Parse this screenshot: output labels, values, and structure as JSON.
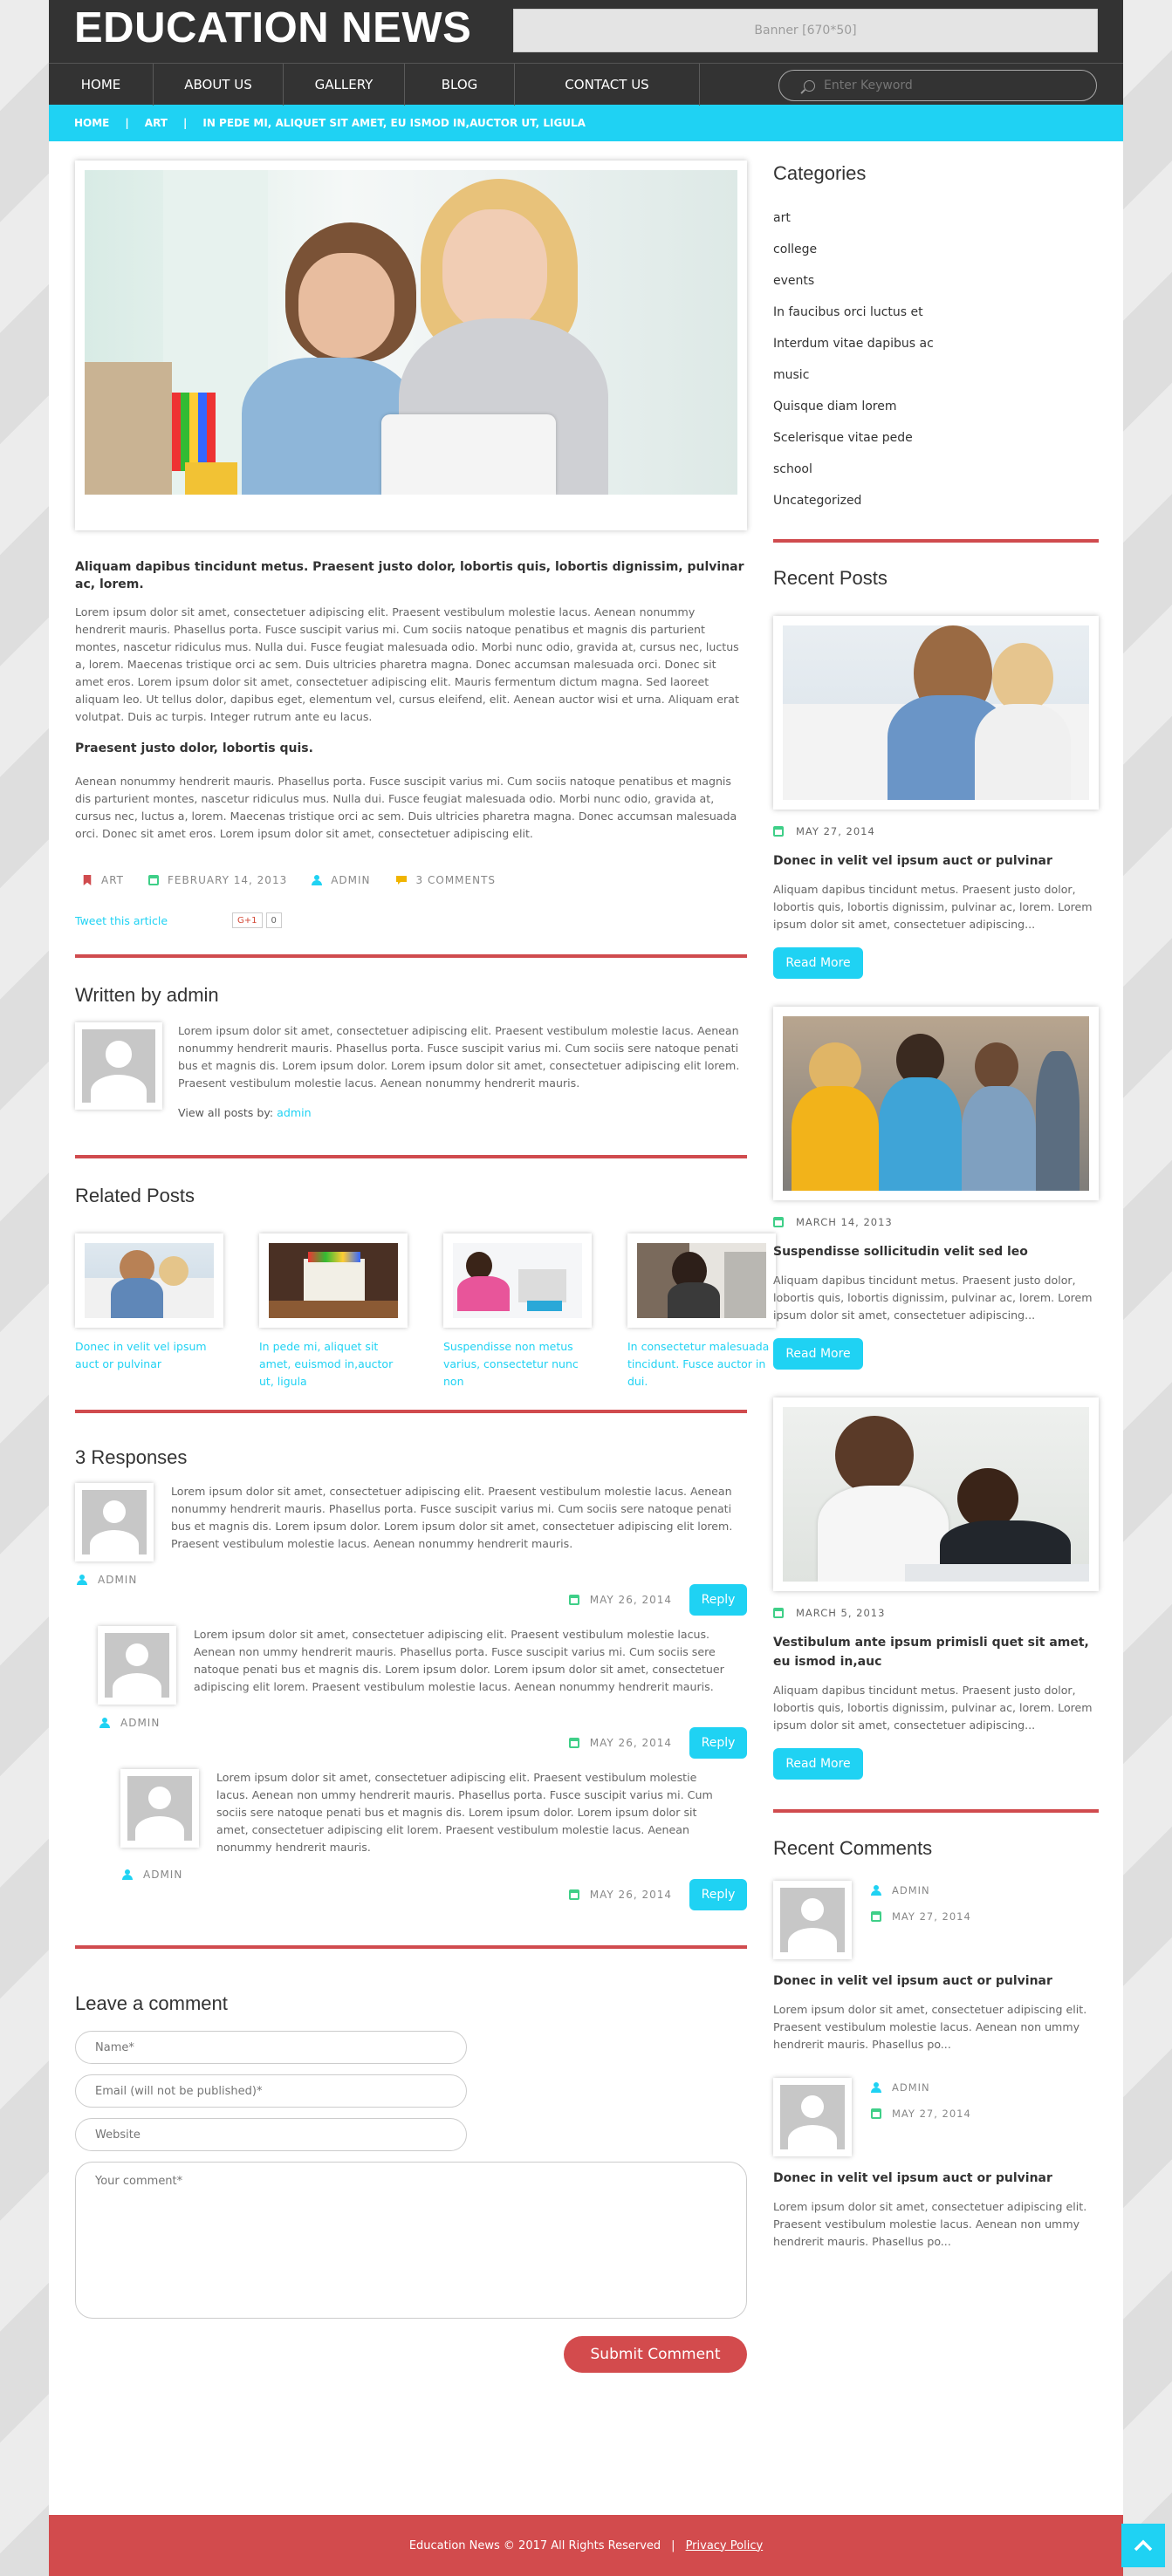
{
  "header": {
    "logo": "EDUCATION NEWS",
    "banner": "Banner [670*50]"
  },
  "nav": {
    "items": [
      "HOME",
      "ABOUT US",
      "GALLERY",
      "BLOG",
      "CONTACT US"
    ],
    "search_placeholder": "Enter Keyword"
  },
  "breadcrumb": {
    "items": [
      "HOME",
      "ART",
      "IN PEDE MI, ALIQUET SIT AMET, EU ISMOD IN,AUCTOR UT, LIGULA"
    ]
  },
  "article": {
    "lead": "Aliquam dapibus tincidunt metus. Praesent justo dolor, lobortis quis, lobortis dignissim, pulvinar ac, lorem.",
    "para1": "Lorem ipsum dolor sit amet, consectetuer adipiscing elit. Praesent vestibulum molestie lacus. Aenean nonummy hendrerit mauris. Phasellus porta. Fusce suscipit varius mi. Cum sociis natoque penatibus et magnis dis parturient montes, nascetur ridiculus mus. Nulla dui. Fusce feugiat malesuada odio. Morbi nunc odio, gravida at, cursus nec, luctus a, lorem. Maecenas tristique orci ac sem. Duis ultricies pharetra magna. Donec accumsan malesuada orci. Donec sit amet eros. Lorem ipsum dolor sit amet, consectetuer adipiscing elit. Mauris fermentum dictum magna. Sed laoreet aliquam leo. Ut tellus dolor, dapibus eget, elementum vel, cursus eleifend, elit. Aenean auctor wisi et urna. Aliquam erat volutpat. Duis ac turpis. Integer rutrum ante eu lacus.",
    "subhead": "Praesent justo dolor, lobortis quis.",
    "para2": "Aenean nonummy hendrerit mauris. Phasellus porta. Fusce suscipit varius mi. Cum sociis natoque penatibus et magnis dis parturient montes, nascetur ridiculus mus. Nulla dui. Fusce feugiat malesuada odio. Morbi nunc odio, gravida at, cursus nec, luctus a, lorem. Maecenas tristique orci ac sem. Duis ultricies pharetra magna. Donec accumsan malesuada orci. Donec sit amet eros. Lorem ipsum dolor sit amet, consectetuer adipiscing elit.",
    "meta": {
      "category": "ART",
      "date": "FEBRUARY 14, 2013",
      "author": "ADMIN",
      "comments": "3 COMMENTS"
    },
    "tweet": "Tweet this article",
    "gplus_label": "G+1",
    "gplus_count": "0"
  },
  "author_box": {
    "title": "Written by admin",
    "bio": "Lorem ipsum dolor sit amet, consectetuer adipiscing elit. Praesent vestibulum molestie lacus. Aenean nonummy hendrerit mauris. Phasellus porta. Fusce suscipit varius mi. Cum sociis sere natoque penati bus et magnis dis. Lorem ipsum dolor. Lorem ipsum dolor sit amet, consectetuer adipiscing elit lorem. Praesent vestibulum molestie lacus. Aenean nonummy hendrerit mauris.",
    "view_all_label": "View all posts by:",
    "view_all_link": "admin"
  },
  "related": {
    "title": "Related Posts",
    "items": [
      "Donec in velit vel ipsum auct or pulvinar",
      "In pede mi, aliquet sit amet, euismod in,auctor ut, ligula",
      "Suspendisse non metus varius, consectetur nunc non",
      "In consectetur malesuada tincidunt. Fusce auctor in dui."
    ]
  },
  "responses": {
    "title": "3 Responses",
    "items": [
      {
        "text": "Lorem ipsum dolor sit amet, consectetuer adipiscing elit. Praesent vestibulum molestie lacus. Aenean nonummy hendrerit mauris. Phasellus porta. Fusce suscipit varius mi. Cum sociis sere natoque penati bus et magnis dis. Lorem ipsum dolor. Lorem ipsum dolor sit amet, consectetuer adipiscing elit lorem. Praesent vestibulum molestie lacus. Aenean nonummy hendrerit mauris.",
        "author": "ADMIN",
        "date": "MAY 26, 2014",
        "reply": "Reply"
      },
      {
        "text": "Lorem ipsum dolor sit amet, consectetuer adipiscing elit. Praesent vestibulum molestie lacus. Aenean non ummy hendrerit mauris. Phasellus porta. Fusce suscipit varius mi. Cum sociis sere natoque penati bus et magnis dis. Lorem ipsum dolor. Lorem ipsum dolor sit amet, consectetuer adipiscing elit lorem. Praesent vestibulum molestie lacus. Aenean nonummy hendrerit mauris.",
        "author": "ADMIN",
        "date": "MAY 26, 2014",
        "reply": "Reply"
      },
      {
        "text": "Lorem ipsum dolor sit amet, consectetuer adipiscing elit. Praesent vestibulum molestie lacus. Aenean non ummy hendrerit mauris. Phasellus porta. Fusce suscipit varius mi. Cum sociis sere natoque penati bus et magnis dis. Lorem ipsum dolor. Lorem ipsum dolor sit amet, consectetuer adipiscing elit lorem. Praesent vestibulum molestie lacus. Aenean nonummy hendrerit mauris.",
        "author": "ADMIN",
        "date": "MAY 26, 2014",
        "reply": "Reply"
      }
    ]
  },
  "comment_form": {
    "title": "Leave a comment",
    "name_placeholder": "Name*",
    "email_placeholder": "Email (will not be published)*",
    "website_placeholder": "Website",
    "comment_placeholder": "Your comment*",
    "submit": "Submit Comment"
  },
  "sidebar": {
    "categories_title": "Categories",
    "categories": [
      "art",
      "college",
      "events",
      "In faucibus orci luctus et",
      "Interdum vitae dapibus ac",
      "music",
      "Quisque diam lorem",
      "Scelerisque vitae pede",
      "school",
      "Uncategorized"
    ],
    "recent_posts_title": "Recent Posts",
    "recent_posts": [
      {
        "date": "MAY 27, 2014",
        "title": "Donec in velit vel ipsum auct or pulvinar",
        "excerpt": "Aliquam dapibus tincidunt metus. Praesent justo dolor, lobortis quis, lobortis dignissim, pulvinar ac, lorem. Lorem ipsum dolor sit amet, consectetuer adipiscing...",
        "button": "Read More"
      },
      {
        "date": "MARCH 14, 2013",
        "title": "Suspendisse sollicitudin velit sed leo",
        "excerpt": "Aliquam dapibus tincidunt metus. Praesent justo dolor, lobortis quis, lobortis dignissim, pulvinar ac, lorem. Lorem ipsum dolor sit amet, consectetuer adipiscing...",
        "button": "Read More"
      },
      {
        "date": "MARCH 5, 2013",
        "title": "Vestibulum ante ipsum primisli quet sit amet, eu ismod in,auc",
        "excerpt": "Aliquam dapibus tincidunt metus. Praesent justo dolor, lobortis quis, lobortis dignissim, pulvinar ac, lorem. Lorem ipsum dolor sit amet, consectetuer adipiscing...",
        "button": "Read More"
      }
    ],
    "recent_comments_title": "Recent Comments",
    "recent_comments": [
      {
        "author": "ADMIN",
        "date": "MAY 27, 2014",
        "title": "Donec in velit vel ipsum auct or pulvinar",
        "excerpt": "Lorem ipsum dolor sit amet, consectetuer adipiscing elit. Praesent vestibulum molestie lacus. Aenean non ummy hendrerit mauris. Phasellus po..."
      },
      {
        "author": "ADMIN",
        "date": "MAY 27, 2014",
        "title": "Donec in velit vel ipsum auct or pulvinar",
        "excerpt": "Lorem ipsum dolor sit amet, consectetuer adipiscing elit. Praesent vestibulum molestie lacus. Aenean non ummy hendrerit mauris. Phasellus po..."
      }
    ]
  },
  "footer": {
    "copyright": "Education News © 2017 All Rights Reserved",
    "separator": "|",
    "privacy": "Privacy Policy"
  },
  "colors": {
    "accent": "#1fd2f3",
    "red": "#d04b4e",
    "header": "#333333",
    "green_icon": "#3fcf88"
  }
}
